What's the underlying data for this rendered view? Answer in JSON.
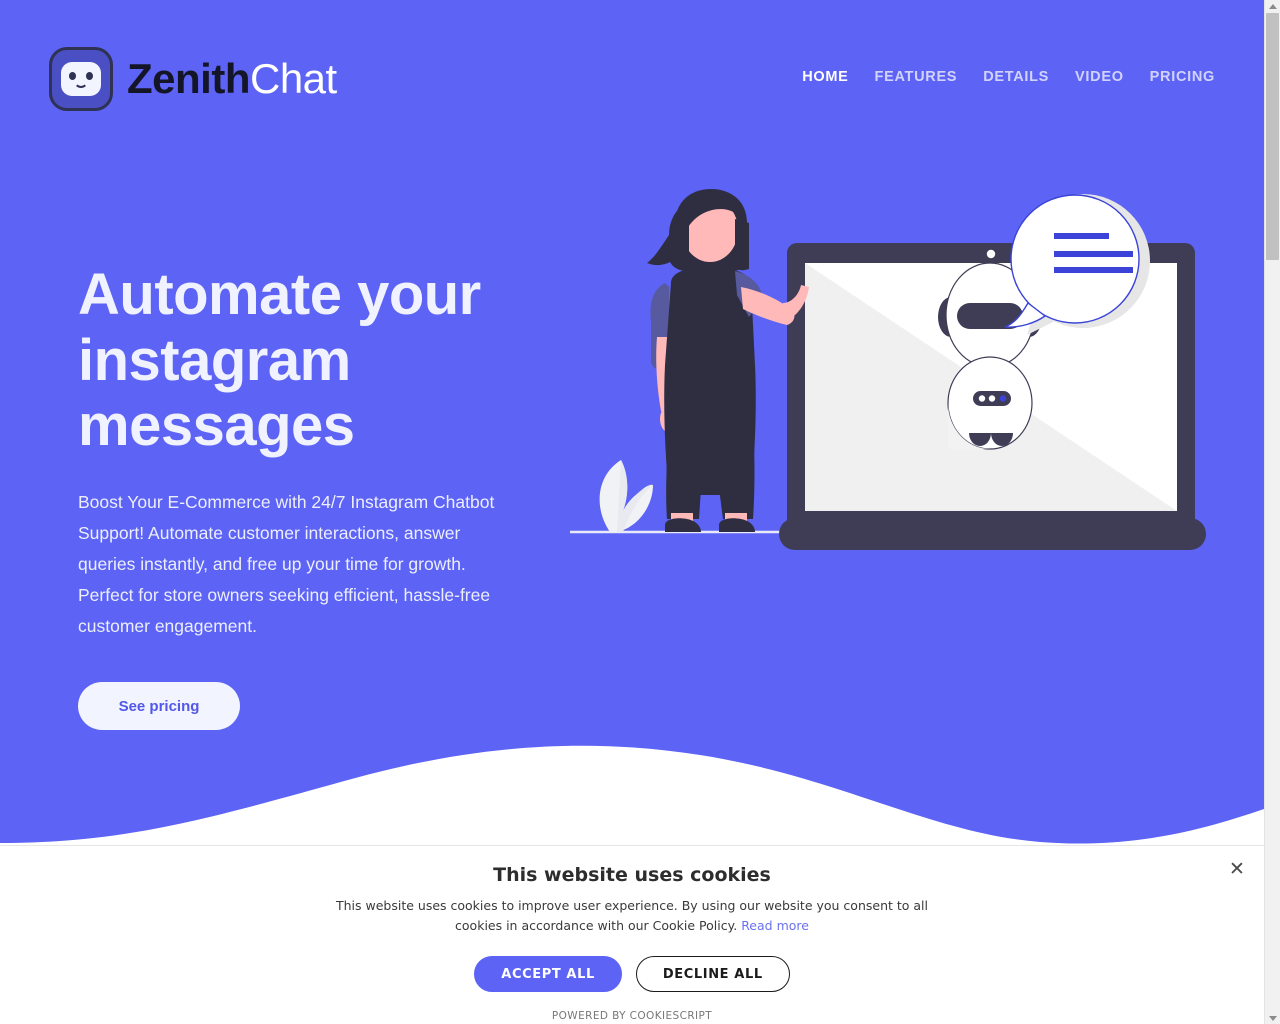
{
  "brand": {
    "name_primary": "Zenith",
    "name_secondary": "Chat",
    "logo_icon": "robot-face-icon"
  },
  "nav": {
    "items": [
      {
        "label": "HOME",
        "active": true
      },
      {
        "label": "FEATURES",
        "active": false
      },
      {
        "label": "DETAILS",
        "active": false
      },
      {
        "label": "VIDEO",
        "active": false
      },
      {
        "label": "PRICING",
        "active": false
      }
    ]
  },
  "hero": {
    "title": "Automate your instagram messages",
    "subtitle": "Boost Your E-Commerce with 24/7 Instagram Chatbot Support! Automate customer interactions, answer queries instantly, and free up your time for growth. Perfect for store owners seeking efficient, hassle-free customer engagement.",
    "cta_label": "See pricing",
    "background_color": "#5C63F5",
    "illustration": "woman-with-laptop-chatbot-illustration"
  },
  "cookie_banner": {
    "title": "This website uses cookies",
    "description": "This website uses cookies to improve user experience. By using our website you consent to all cookies in accordance with our Cookie Policy.",
    "read_more_label": "Read more",
    "accept_label": "ACCEPT ALL",
    "decline_label": "DECLINE ALL",
    "powered_by": "POWERED BY COOKIESCRIPT",
    "close_icon": "✕",
    "accent_color": "#5C63F5"
  },
  "scrollbar": {
    "up_icon": "chevron-up-icon",
    "down_icon": "chevron-down-icon"
  }
}
